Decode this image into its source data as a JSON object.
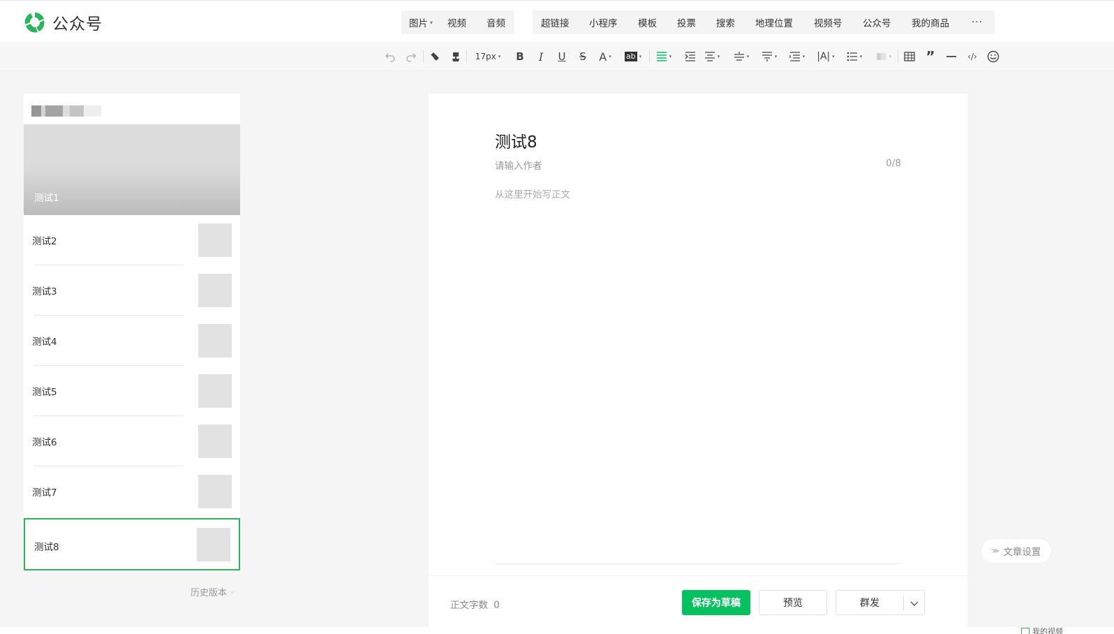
{
  "header": {
    "app_name": "公众号",
    "insert_media": [
      {
        "label": "图片",
        "has_caret": true
      },
      {
        "label": "视频"
      },
      {
        "label": "音频"
      }
    ],
    "insert_more": [
      "超链接",
      "小程序",
      "模板",
      "投票",
      "搜索",
      "地理位置",
      "视频号",
      "公众号",
      "我的商品"
    ],
    "more_label": "···"
  },
  "toolbar": {
    "font_size": "17px",
    "bold": "B",
    "italic": "I",
    "underline": "U",
    "strike": "S",
    "font_color": "A",
    "bg_color": "ab",
    "letter_spacing": "|A|"
  },
  "articles": {
    "cover_title": "测试1",
    "items": [
      "测试2",
      "测试3",
      "测试4",
      "测试5",
      "测试6",
      "测试7"
    ],
    "active_title": "测试8"
  },
  "history_label": "历史版本",
  "editor": {
    "title": "测试8",
    "author_placeholder": "请输入作者",
    "author_count": "0/8",
    "body_placeholder": "从这里开始写正文",
    "word_count_label": "正文字数",
    "word_count": "0",
    "save_label": "保存为草稿",
    "preview_label": "预览",
    "publish_label": "群发"
  },
  "settings_label": "文章设置",
  "footer_snippet": "我的视频",
  "colors": {
    "brand_green": "#07c160",
    "active_border": "#2db35c"
  }
}
